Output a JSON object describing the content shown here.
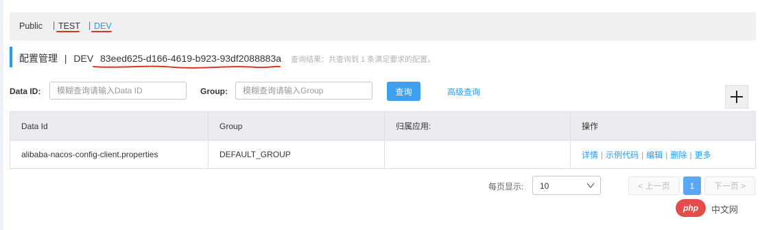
{
  "namespaces": [
    {
      "label": "Public"
    },
    {
      "label": "TEST"
    },
    {
      "label": "DEV"
    }
  ],
  "separator": "|",
  "colors": {
    "accent": "#209bfa",
    "annotation": "#d9351f",
    "primary_button": "#3e9fef"
  },
  "header": {
    "title": "配置管理",
    "divider": "|",
    "namespace_name": "DEV",
    "namespace_id": "83eed625-d166-4619-b923-93df2088883a",
    "query_result": "查询结果：共查询到 1 条满足要求的配置。"
  },
  "search": {
    "data_id_label": "Data ID:",
    "data_id_placeholder": "模糊查询请输入Data ID",
    "group_label": "Group:",
    "group_placeholder": "模糊查询请输入Group",
    "query_button": "查询",
    "advanced_link": "高级查询",
    "add_icon": "plus-icon"
  },
  "table": {
    "columns": [
      "Data Id",
      "Group",
      "归属应用:",
      "操作"
    ],
    "rows": [
      {
        "data_id": "alibaba-nacos-config-client.properties",
        "group": "DEFAULT_GROUP",
        "app": "",
        "actions": [
          "详情",
          "示例代码",
          "编辑",
          "删除",
          "更多"
        ]
      }
    ]
  },
  "pagination": {
    "page_size_label": "每页显示:",
    "page_size": "10",
    "prev": "< 上一页",
    "current_page": "1",
    "next": "下一页 >"
  },
  "watermark": {
    "badge": "php",
    "text": "中文网"
  }
}
